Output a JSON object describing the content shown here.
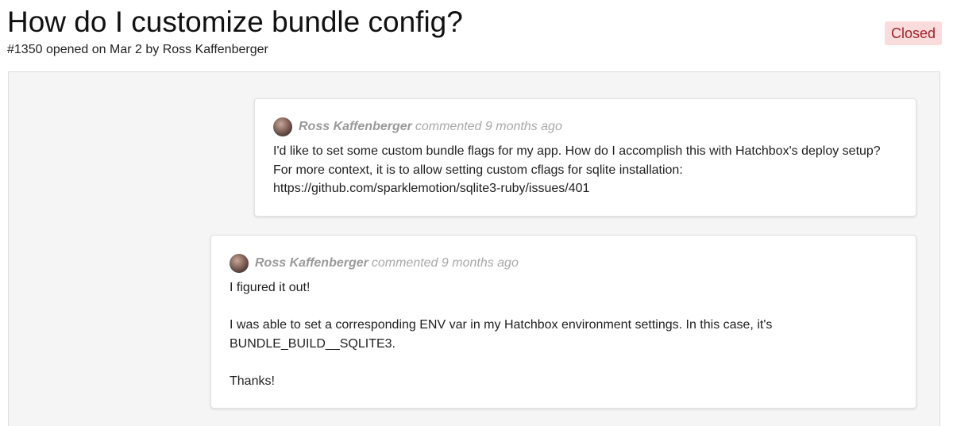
{
  "issue": {
    "title": "How do I customize bundle config?",
    "meta": "#1350 opened on Mar 2 by Ross Kaffenberger",
    "status": "Closed"
  },
  "comments": [
    {
      "author": "Ross Kaffenberger",
      "action": "commented 9 months ago",
      "paragraphs": [
        "I'd like to set some custom bundle flags for my app. How do I accomplish this with Hatchbox's deploy setup? For more context, it is to allow setting custom cflags for sqlite installation: https://github.com/sparklemotion/sqlite3-ruby/issues/401"
      ]
    },
    {
      "author": "Ross Kaffenberger",
      "action": "commented 9 months ago",
      "paragraphs": [
        "I figured it out!",
        "I was able to set a corresponding ENV var in my Hatchbox environment settings. In this case, it's BUNDLE_BUILD__SQLITE3.",
        "Thanks!"
      ]
    }
  ],
  "icons": {
    "avatar": "user-avatar-photo"
  },
  "colors": {
    "status_text": "#a0232b",
    "status_bg": "#fadcdc",
    "meta_text": "#9a9a9a"
  }
}
